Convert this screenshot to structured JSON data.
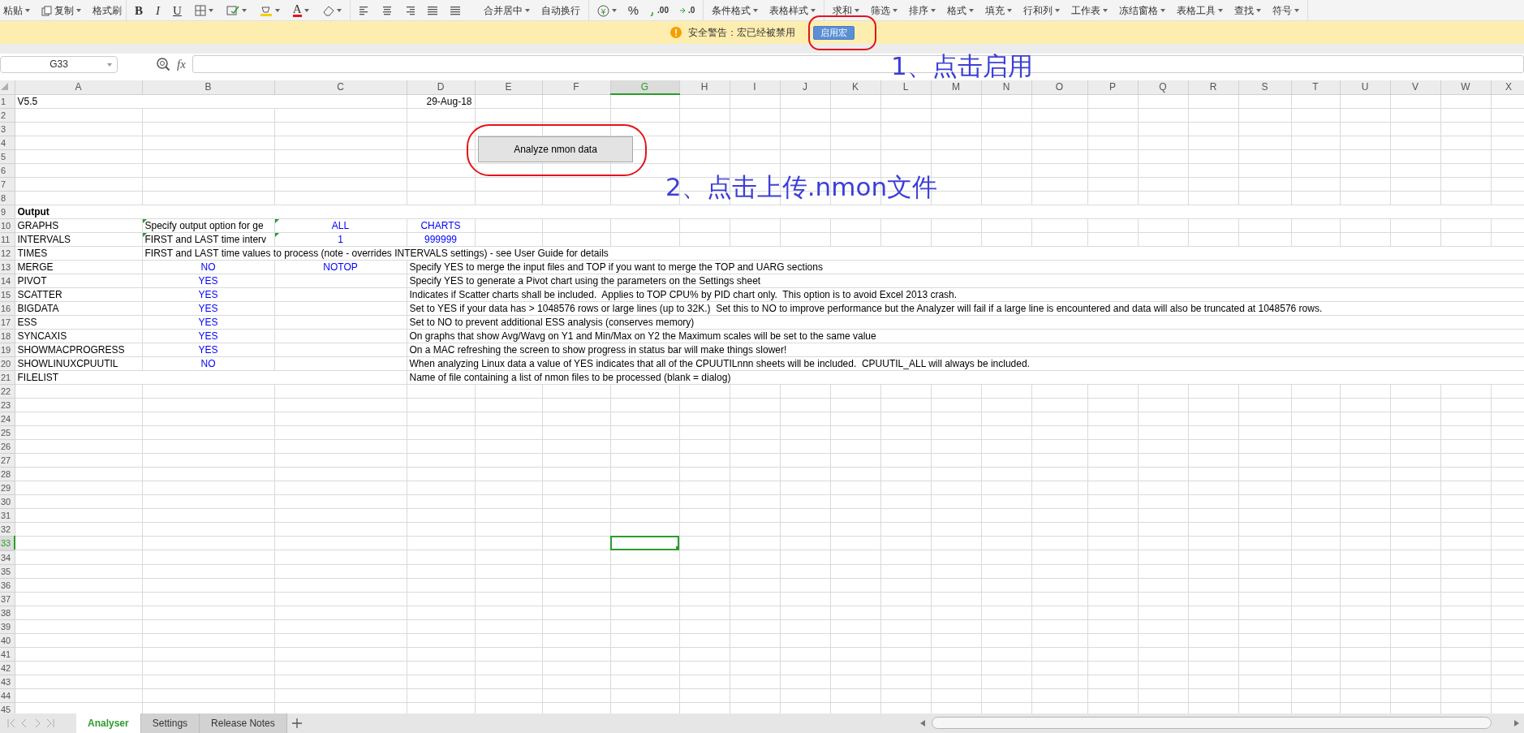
{
  "toolbar": {
    "groups": [
      {
        "items": [
          "粘贴",
          "复制",
          "格式刷"
        ]
      },
      {
        "items": [
          "B",
          "I",
          "U",
          "A"
        ]
      },
      {
        "items": [
          "合并居中",
          "自动换行"
        ]
      },
      {
        "items": [
          "%",
          ".00",
          ".0"
        ]
      },
      {
        "items": [
          "条件格式",
          "表格样式"
        ]
      },
      {
        "items": [
          "求和",
          "筛选",
          "排序",
          "格式",
          "填充",
          "行和列",
          "工作表",
          "冻结窗格",
          "表格工具",
          "查找",
          "符号"
        ]
      }
    ]
  },
  "security_bar": {
    "message": "安全警告：宏已经被禁用",
    "button": "启用宏"
  },
  "formula_bar": {
    "name_box": "G33",
    "fx": "fx"
  },
  "columns": [
    {
      "label": "A",
      "selected": false
    },
    {
      "label": "B",
      "selected": false
    },
    {
      "label": "C",
      "selected": false
    },
    {
      "label": "D",
      "selected": false
    },
    {
      "label": "E",
      "selected": false
    },
    {
      "label": "F",
      "selected": false
    },
    {
      "label": "G",
      "selected": true
    },
    {
      "label": "H",
      "selected": false
    },
    {
      "label": "I",
      "selected": false
    },
    {
      "label": "J",
      "selected": false
    },
    {
      "label": "K",
      "selected": false
    },
    {
      "label": "L",
      "selected": false
    },
    {
      "label": "M",
      "selected": false
    },
    {
      "label": "N",
      "selected": false
    },
    {
      "label": "O",
      "selected": false
    },
    {
      "label": "P",
      "selected": false
    },
    {
      "label": "Q",
      "selected": false
    },
    {
      "label": "R",
      "selected": false
    },
    {
      "label": "S",
      "selected": false
    },
    {
      "label": "T",
      "selected": false
    },
    {
      "label": "U",
      "selected": false
    },
    {
      "label": "V",
      "selected": false
    },
    {
      "label": "W",
      "selected": false
    },
    {
      "label": "X",
      "selected": false
    }
  ],
  "rows": [
    {
      "number": "1",
      "selected": false,
      "cells": [
        {
          "kind": "text",
          "text": "V5.5"
        },
        {
          "kind": "blank"
        },
        {
          "kind": "blank"
        },
        {
          "kind": "date",
          "text": "29-Aug-18"
        }
      ]
    },
    {
      "number": "2",
      "selected": false
    },
    {
      "number": "3",
      "selected": false
    },
    {
      "number": "4",
      "selected": false
    },
    {
      "number": "5",
      "selected": false
    },
    {
      "number": "6",
      "selected": false
    },
    {
      "number": "7",
      "selected": false
    },
    {
      "number": "8",
      "selected": false
    },
    {
      "number": "9",
      "selected": false,
      "cells": [
        {
          "kind": "heading",
          "text": "Output"
        }
      ]
    },
    {
      "number": "10",
      "selected": false,
      "cells": [
        {
          "kind": "text",
          "text": "GRAPHS"
        },
        {
          "kind": "text",
          "text": "Specify output option for ge",
          "marker": true
        },
        {
          "kind": "value",
          "text": "ALL",
          "marker": true
        },
        {
          "kind": "value",
          "text": "CHARTS"
        }
      ]
    },
    {
      "number": "11",
      "selected": false,
      "cells": [
        {
          "kind": "text",
          "text": "INTERVALS"
        },
        {
          "kind": "text",
          "text": "FIRST and LAST time interv",
          "marker": true
        },
        {
          "kind": "value",
          "text": "1",
          "marker": true
        },
        {
          "kind": "value",
          "text": "999999"
        }
      ]
    },
    {
      "number": "12",
      "selected": false,
      "cells": [
        {
          "kind": "text",
          "text": "TIMES"
        },
        {
          "kind": "text",
          "text": "FIRST and LAST time values to process (note - overrides INTERVALS settings) - see User Guide for details"
        }
      ]
    },
    {
      "number": "13",
      "selected": false,
      "cells": [
        {
          "kind": "text",
          "text": "MERGE"
        },
        {
          "kind": "value",
          "text": "NO"
        },
        {
          "kind": "value",
          "text": "NOTOP"
        },
        {
          "kind": "text",
          "text": "Specify YES to merge the input files and TOP if you want to merge the TOP and UARG sections"
        }
      ]
    },
    {
      "number": "14",
      "selected": false,
      "cells": [
        {
          "kind": "text",
          "text": "PIVOT"
        },
        {
          "kind": "value",
          "text": "YES"
        },
        {
          "kind": "blank"
        },
        {
          "kind": "text",
          "text": "Specify YES to generate a Pivot chart using the parameters on the Settings sheet"
        }
      ]
    },
    {
      "number": "15",
      "selected": false,
      "cells": [
        {
          "kind": "text",
          "text": "SCATTER"
        },
        {
          "kind": "value",
          "text": "YES"
        },
        {
          "kind": "blank"
        },
        {
          "kind": "text",
          "text": "Indicates if Scatter charts shall be included.  Applies to TOP CPU% by PID chart only.  This option is to avoid Excel 2013 crash."
        }
      ]
    },
    {
      "number": "16",
      "selected": false,
      "cells": [
        {
          "kind": "text",
          "text": "BIGDATA"
        },
        {
          "kind": "value",
          "text": "YES"
        },
        {
          "kind": "blank"
        },
        {
          "kind": "text",
          "text": "Set to YES if your data has > 1048576 rows or large lines (up to 32K.)  Set this to NO to improve performance but the Analyzer will fail if a large line is encountered and data will also be truncated at 1048576 rows."
        }
      ]
    },
    {
      "number": "17",
      "selected": false,
      "cells": [
        {
          "kind": "text",
          "text": "ESS"
        },
        {
          "kind": "value",
          "text": "YES"
        },
        {
          "kind": "blank"
        },
        {
          "kind": "text",
          "text": "Set to NO to prevent additional ESS analysis (conserves memory)"
        }
      ]
    },
    {
      "number": "18",
      "selected": false,
      "cells": [
        {
          "kind": "text",
          "text": "SYNCAXIS"
        },
        {
          "kind": "value",
          "text": "YES"
        },
        {
          "kind": "blank"
        },
        {
          "kind": "text",
          "text": "On graphs that show Avg/Wavg on Y1 and Min/Max on Y2 the Maximum scales will be set to the same value"
        }
      ]
    },
    {
      "number": "19",
      "selected": false,
      "cells": [
        {
          "kind": "text",
          "text": "SHOWMACPROGRESS"
        },
        {
          "kind": "value",
          "text": "YES"
        },
        {
          "kind": "blank"
        },
        {
          "kind": "text",
          "text": "On a MAC refreshing the screen to show progress in status bar will make things slower!"
        }
      ]
    },
    {
      "number": "20",
      "selected": false,
      "cells": [
        {
          "kind": "text",
          "text": "SHOWLINUXCPUUTIL"
        },
        {
          "kind": "value",
          "text": "NO"
        },
        {
          "kind": "blank"
        },
        {
          "kind": "text",
          "text": "When analyzing Linux data a value of YES indicates that all of the CPUUTILnnn sheets will be included.  CPUUTIL_ALL will always be included."
        }
      ]
    },
    {
      "number": "21",
      "selected": false,
      "cells": [
        {
          "kind": "text",
          "text": "FILELIST"
        },
        {
          "kind": "blank"
        },
        {
          "kind": "blank"
        },
        {
          "kind": "text",
          "text": "Name of file containing a list of nmon files to be processed (blank = dialog)"
        }
      ]
    },
    {
      "number": "22",
      "selected": false
    },
    {
      "number": "23",
      "selected": false
    },
    {
      "number": "24",
      "selected": false
    },
    {
      "number": "25",
      "selected": false
    },
    {
      "number": "26",
      "selected": false
    },
    {
      "number": "27",
      "selected": false
    },
    {
      "number": "28",
      "selected": false
    },
    {
      "number": "29",
      "selected": false
    },
    {
      "number": "30",
      "selected": false
    },
    {
      "number": "31",
      "selected": false
    },
    {
      "number": "32",
      "selected": false
    },
    {
      "number": "33",
      "selected": true
    },
    {
      "number": "34",
      "selected": false
    },
    {
      "number": "35",
      "selected": false
    },
    {
      "number": "36",
      "selected": false
    },
    {
      "number": "37",
      "selected": false
    },
    {
      "number": "38",
      "selected": false
    },
    {
      "number": "39",
      "selected": false
    },
    {
      "number": "40",
      "selected": false
    },
    {
      "number": "41",
      "selected": false
    },
    {
      "number": "42",
      "selected": false
    },
    {
      "number": "43",
      "selected": false
    },
    {
      "number": "44",
      "selected": false
    },
    {
      "number": "45",
      "selected": false
    }
  ],
  "macro_button": {
    "label": "Analyze nmon data"
  },
  "annotations": [
    "1、点击启用",
    "2、点击上传.nmon文件"
  ],
  "sheet_tabs": [
    {
      "label": "Analyser",
      "selected": true
    },
    {
      "label": "Settings",
      "selected": false
    },
    {
      "label": "Release Notes",
      "selected": false
    }
  ]
}
